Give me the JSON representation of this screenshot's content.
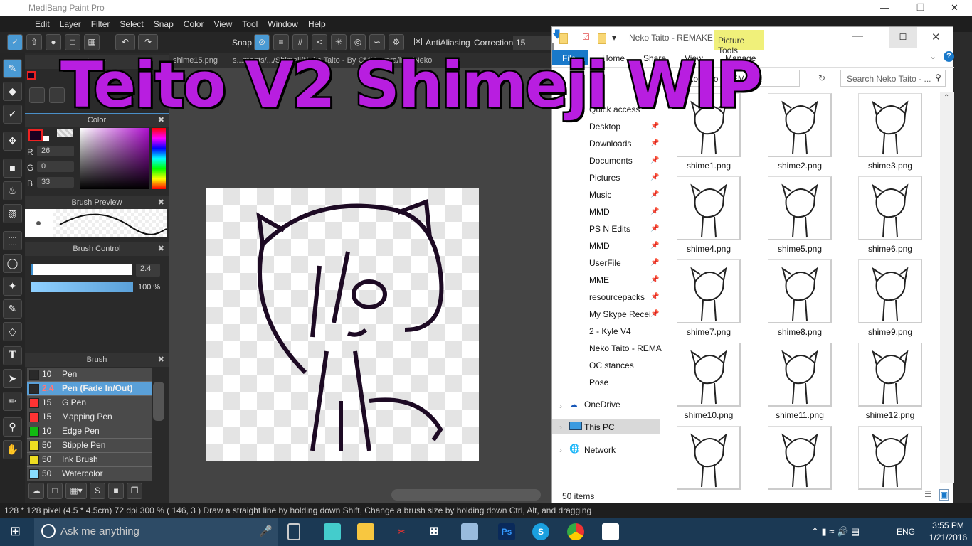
{
  "app": {
    "title": "MediBang Paint Pro",
    "menu": [
      "Edit",
      "Layer",
      "Filter",
      "Select",
      "Snap",
      "Color",
      "View",
      "Tool",
      "Window",
      "Help"
    ]
  },
  "toolbar": {
    "snap_label": "Snap",
    "antialiasing_label": "AntiAliasing",
    "antialiasing_checked": true,
    "correction_label": "Correction",
    "correction_value": "15"
  },
  "document_tab": {
    "name": "shime15.png",
    "path": "s...ments/.../Shimeji/Neko Taito - By CMHerrera/img/Neko"
  },
  "panels": {
    "layer": {
      "title": "Layer"
    },
    "color": {
      "title": "Color",
      "r_label": "R",
      "g_label": "G",
      "b_label": "B",
      "r": "26",
      "g": "0",
      "b": "33",
      "foreground": "#1a0021",
      "background": "#ffffff"
    },
    "brush_preview": {
      "title": "Brush Preview"
    },
    "brush_control": {
      "title": "Brush Control",
      "size": "2.4",
      "opacity": "100 %",
      "opacity_value": 100
    },
    "brush": {
      "title": "Brush",
      "items": [
        {
          "size": "10",
          "name": "Pen",
          "color": "#2a2a2a"
        },
        {
          "size": "2.4",
          "name": "Pen (Fade In/Out)",
          "color": "#2a2a2a",
          "selected": true
        },
        {
          "size": "15",
          "name": "G Pen",
          "color": "#ff3333"
        },
        {
          "size": "15",
          "name": "Mapping Pen",
          "color": "#ff3333"
        },
        {
          "size": "10",
          "name": "Edge Pen",
          "color": "#11bb11"
        },
        {
          "size": "50",
          "name": "Stipple Pen",
          "color": "#eedd22"
        },
        {
          "size": "50",
          "name": "Ink Brush",
          "color": "#eedd22"
        },
        {
          "size": "50",
          "name": "Watercolor",
          "color": "#88ddff"
        }
      ]
    }
  },
  "status": {
    "text": "128 * 128 pixel   (4.5 * 4.5cm)   72 dpi   300 %   ( 146, 3 )   Draw a straight line by holding down Shift, Change a brush size by holding down Ctrl, Alt, and dragging"
  },
  "overlay": {
    "text": "Teito V2 Shimeji WIP",
    "color": "#b81ee0"
  },
  "explorer": {
    "title": "Neko Taito - REMAKE",
    "picture_tools": "Picture Tools",
    "ribbon_tabs": [
      "File",
      "Home",
      "Share",
      "View",
      "Manage"
    ],
    "address": "Neko Taito - REMAKE",
    "search_placeholder": "Search Neko Taito - ...",
    "quick_access": "Quick access",
    "nav": [
      {
        "label": "Desktop",
        "icon": "desktop-icon",
        "pinned": true
      },
      {
        "label": "Downloads",
        "icon": "download-icon",
        "pinned": true
      },
      {
        "label": "Documents",
        "icon": "document-icon",
        "pinned": true
      },
      {
        "label": "Pictures",
        "icon": "pictures-icon",
        "pinned": true
      },
      {
        "label": "Music",
        "icon": "music-icon",
        "pinned": true
      },
      {
        "label": "MMD",
        "icon": "folder-icon",
        "pinned": true
      },
      {
        "label": "PS N Edits",
        "icon": "folder-icon",
        "pinned": true
      },
      {
        "label": "MMD",
        "icon": "folder-icon",
        "pinned": true
      },
      {
        "label": "UserFile",
        "icon": "folder-icon",
        "pinned": true
      },
      {
        "label": "MME",
        "icon": "folder-icon",
        "pinned": true
      },
      {
        "label": "resourcepacks",
        "icon": "folder-icon",
        "pinned": true
      },
      {
        "label": "My Skype Recei",
        "icon": "folder-icon",
        "pinned": true
      },
      {
        "label": "2 - Kyle V4",
        "icon": "folder-icon"
      },
      {
        "label": "Neko Taito - REMA",
        "icon": "folder-icon"
      },
      {
        "label": "OC stances",
        "icon": "folder-icon"
      },
      {
        "label": "Pose",
        "icon": "folder-icon"
      }
    ],
    "roots": [
      "OneDrive",
      "This PC",
      "Network"
    ],
    "files": [
      "shime1.png",
      "shime2.png",
      "shime3.png",
      "shime4.png",
      "shime5.png",
      "shime6.png",
      "shime7.png",
      "shime8.png",
      "shime9.png",
      "shime10.png",
      "shime11.png",
      "shime12.png",
      "",
      "",
      ""
    ],
    "item_count": "50 items"
  },
  "taskbar": {
    "search_placeholder": "Ask me anything",
    "time": "3:55 PM",
    "date": "1/21/2016",
    "language": "ENG"
  }
}
